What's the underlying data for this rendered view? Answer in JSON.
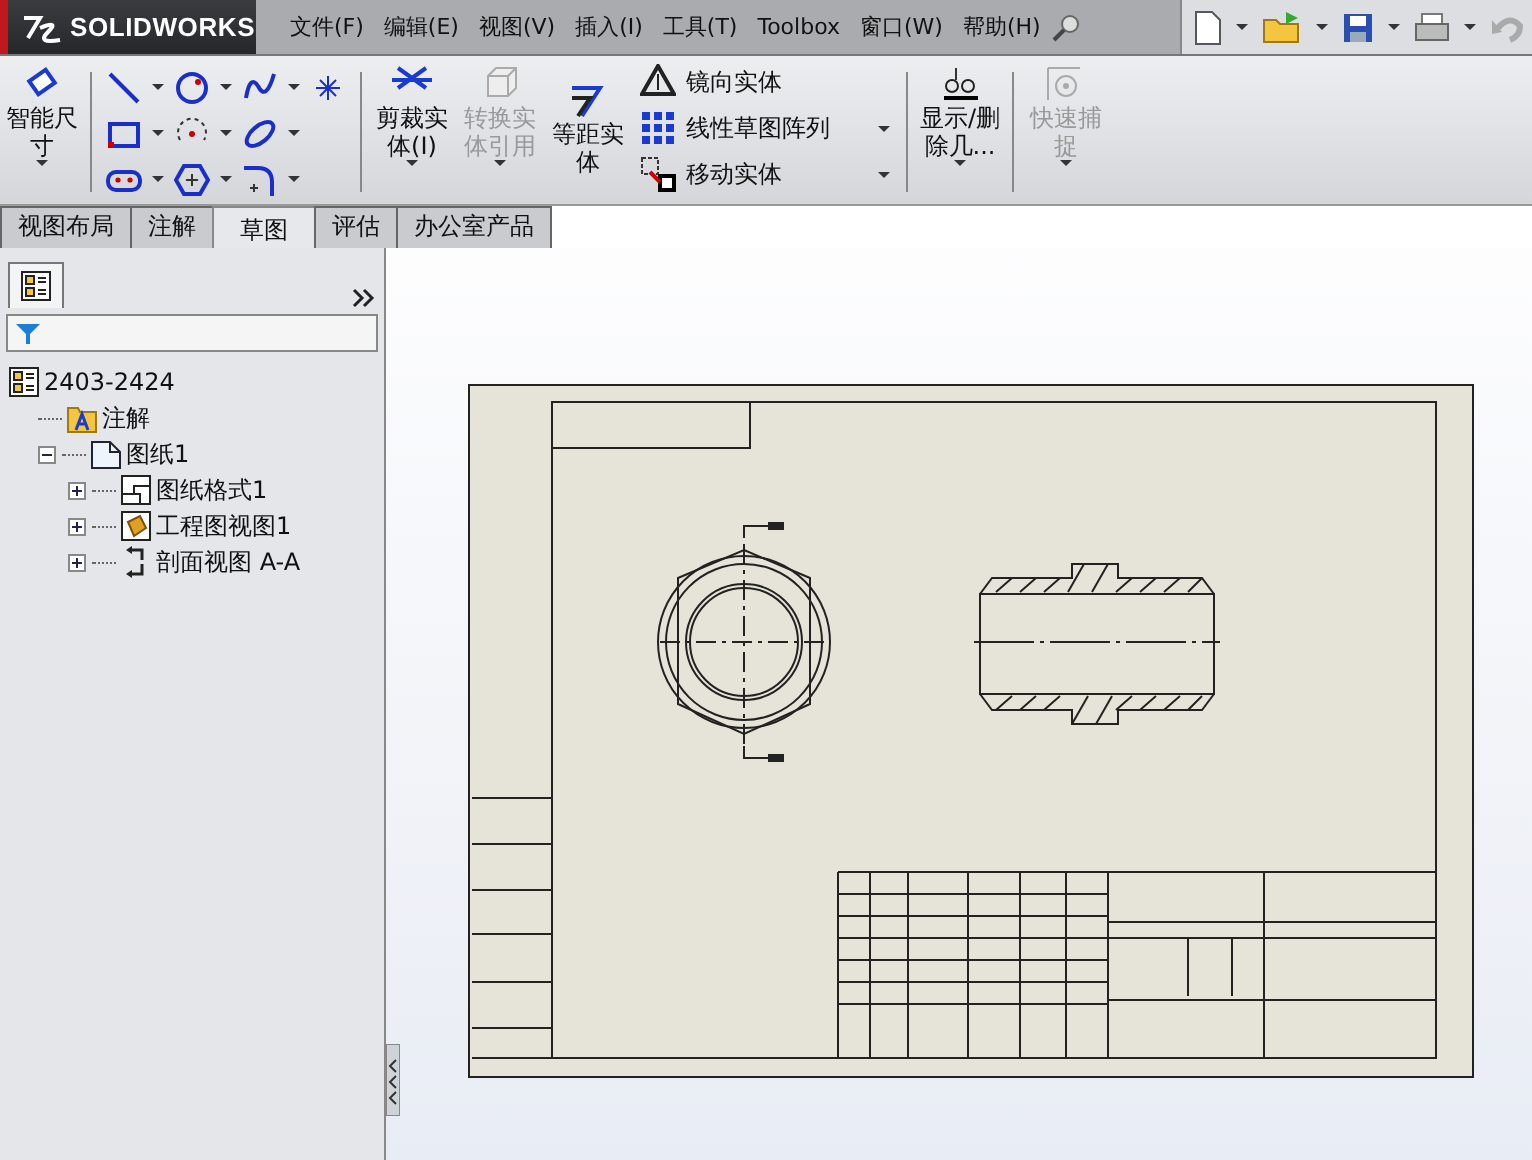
{
  "app": {
    "logo": "SOLIDWORKS"
  },
  "menu": [
    "文件(F)",
    "编辑(E)",
    "视图(V)",
    "插入(I)",
    "工具(T)",
    "Toolbox",
    "窗口(W)",
    "帮助(H)"
  ],
  "ribbon": {
    "smart_dimension": {
      "label": "智能尺寸",
      "disabled": false
    },
    "large_buttons": [
      {
        "label": "剪裁实体(I)",
        "disabled": false,
        "kind": "trim"
      },
      {
        "label": "转换实体引用",
        "disabled": true,
        "kind": "convert"
      },
      {
        "label": "等距实体",
        "disabled": false,
        "kind": "offset"
      }
    ],
    "small_buttons": [
      {
        "label": "镜向实体",
        "kind": "mirror",
        "dropdown": false
      },
      {
        "label": "线性草图阵列",
        "kind": "pattern",
        "dropdown": true
      },
      {
        "label": "移动实体",
        "kind": "move",
        "dropdown": true
      }
    ],
    "extra_buttons": [
      {
        "label": "显示/删除几...",
        "disabled": false,
        "kind": "relations"
      },
      {
        "label": "快速捕捉",
        "disabled": true,
        "kind": "snap"
      }
    ]
  },
  "tabs": [
    {
      "label": "视图布局",
      "selected": false
    },
    {
      "label": "注解",
      "selected": false
    },
    {
      "label": "草图",
      "selected": true
    },
    {
      "label": "评估",
      "selected": false
    },
    {
      "label": "办公室产品",
      "selected": false
    }
  ],
  "tree": {
    "label": "2403-2424",
    "kind": "drawing",
    "children": [
      {
        "label": "注解",
        "kind": "annotations"
      },
      {
        "label": "图纸1",
        "kind": "sheet",
        "expanded": true,
        "children": [
          {
            "label": "图纸格式1",
            "kind": "format",
            "expanded": false
          },
          {
            "label": "工程图视图1",
            "kind": "view",
            "expanded": false
          },
          {
            "label": "剖面视图 A-A",
            "kind": "section",
            "expanded": false
          }
        ]
      }
    ]
  }
}
